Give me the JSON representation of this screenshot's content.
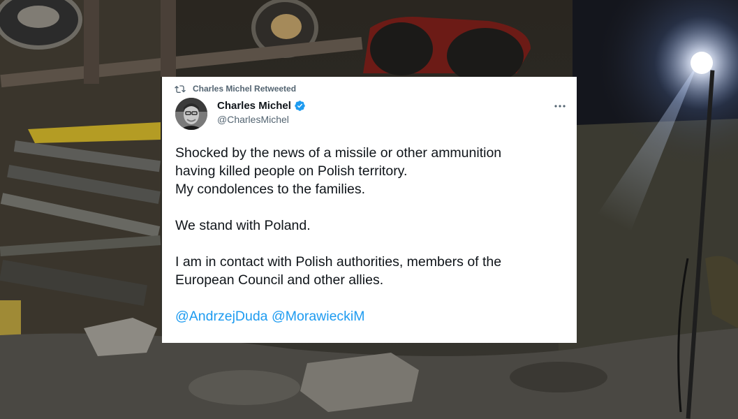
{
  "colors": {
    "accent": "#1d9bf0",
    "text_primary": "#0f1419",
    "text_secondary": "#536471",
    "card_background": "#ffffff"
  },
  "background": {
    "description_icon": "night-explosion-debris-photo"
  },
  "tweet": {
    "retweet_icon": "retweet-icon",
    "retweeted_by": "Charles Michel Retweeted",
    "author_name": "Charles Michel",
    "verified_icon": "verified-badge-icon",
    "author_handle": "@CharlesMichel",
    "more_icon": "more-options-icon",
    "body": {
      "line1": "Shocked by the news of a missile or other ammunition",
      "line2": "having killed people on Polish territory.",
      "line3": "My condolences to the families.",
      "line4": "We stand with Poland.",
      "line5": "I am in contact with Polish authorities, members of the",
      "line6": "European Council and other allies."
    },
    "mentions": [
      "@AndrzejDuda",
      "@MorawieckiM"
    ]
  }
}
